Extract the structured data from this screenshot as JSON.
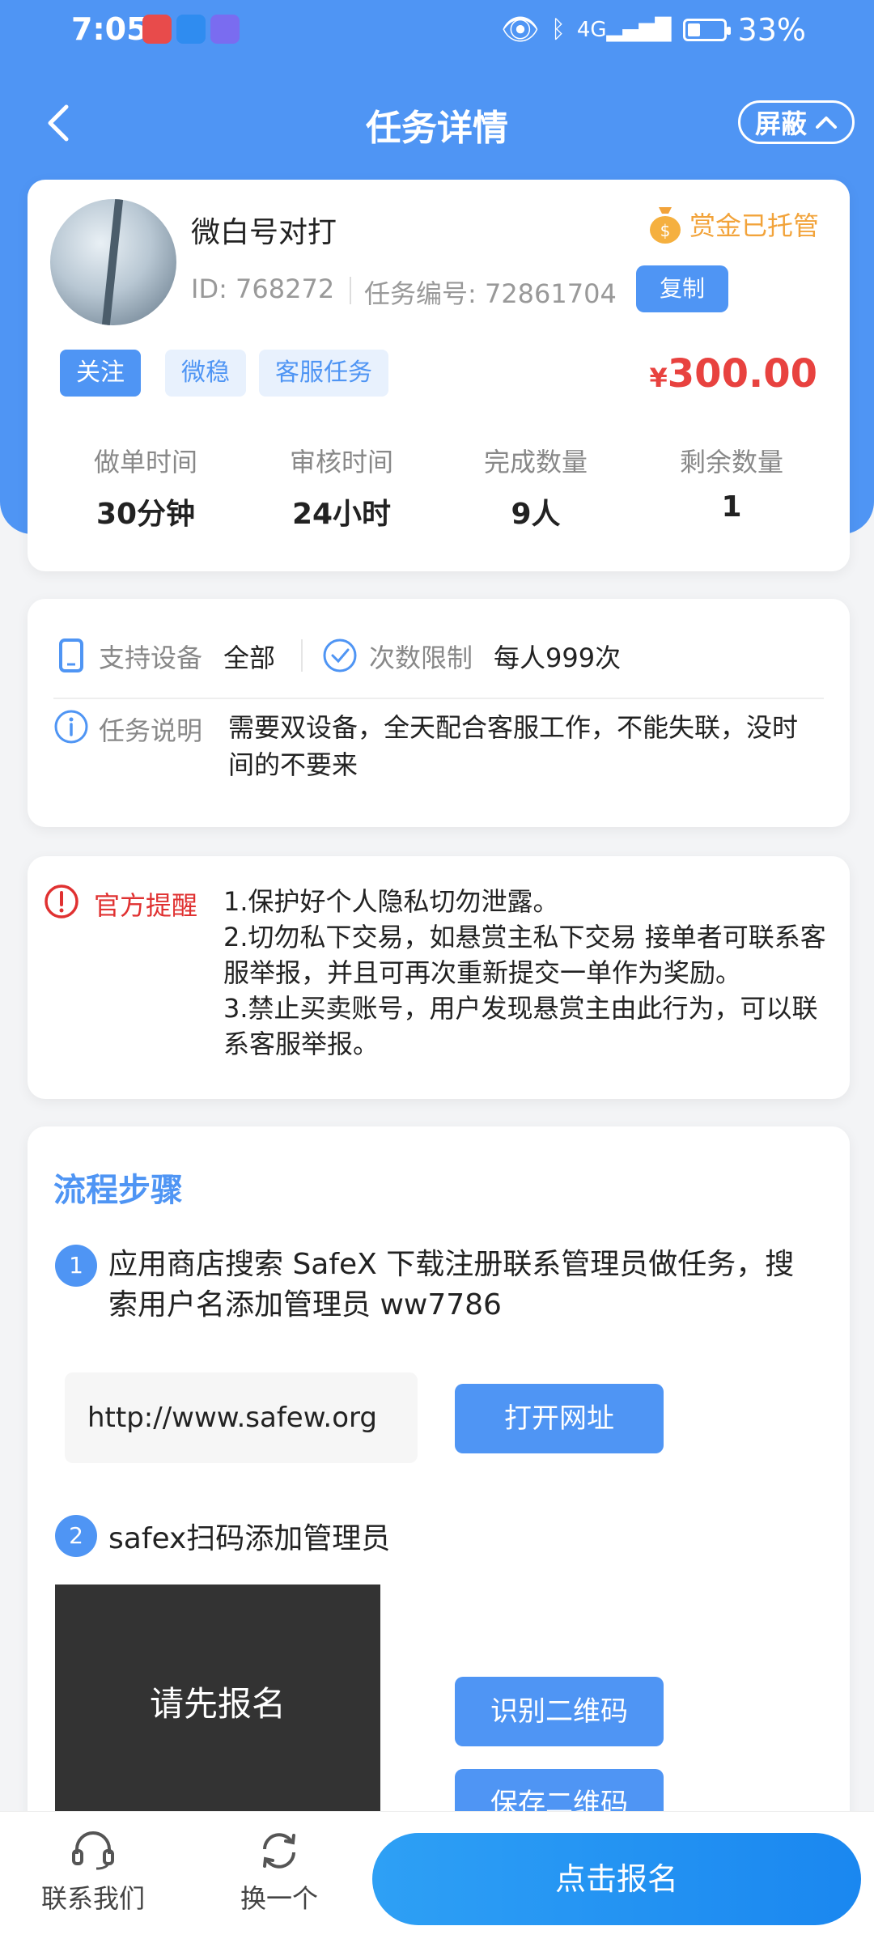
{
  "status_bar": {
    "time": "7:05",
    "battery": "33%",
    "battery_level": 0.33
  },
  "nav": {
    "title": "任务详情",
    "shield_label": "屏蔽"
  },
  "task": {
    "name": "微白号对打",
    "escrow_label": "赏金已托管",
    "id_text": "ID: 768272",
    "task_no_text": "任务编号: 72861704",
    "copy_label": "复制",
    "follow_label": "关注",
    "tags": [
      "微稳",
      "客服任务"
    ],
    "currency": "¥",
    "price": "300.00",
    "stats": [
      {
        "label": "做单时间",
        "value": "30分钟"
      },
      {
        "label": "审核时间",
        "value": "24小时"
      },
      {
        "label": "完成数量",
        "value": "9人"
      },
      {
        "label": "剩余数量",
        "value": "1"
      }
    ]
  },
  "info": {
    "device_label": "支持设备",
    "device_value": "全部",
    "limit_label": "次数限制",
    "limit_value": "每人999次",
    "desc_label": "任务说明",
    "desc_value": "需要双设备，全天配合客服工作，不能失联，没时间的不要来"
  },
  "notice": {
    "label": "官方提醒",
    "lines": [
      "1.保护好个人隐私切勿泄露。",
      "2.切勿私下交易，如悬赏主私下交易 接单者可联系客服举报，并且可再次重新提交一单作为奖励。",
      "3.禁止买卖账号，用户发现悬赏主由此行为，可以联系客服举报。"
    ]
  },
  "steps": {
    "title": "流程步骤",
    "step1_num": "1",
    "step1_text": "应用商店搜索 SafeX 下载注册联系管理员做任务，搜索用户名添加管理员 ww7786",
    "url": "http://www.safew.org",
    "open_url_label": "打开网址",
    "step2_num": "2",
    "step2_text": "safex扫码添加管理员",
    "qr_placeholder": "请先报名",
    "recognize_label": "识别二维码",
    "save_label": "保存二维码"
  },
  "bottom": {
    "contact_label": "联系我们",
    "switch_label": "换一个",
    "signup_label": "点击报名"
  },
  "colors": {
    "primary": "#4f95f4",
    "price": "#e8423f",
    "escrow": "#f2a33a",
    "notice": "#e03131"
  }
}
